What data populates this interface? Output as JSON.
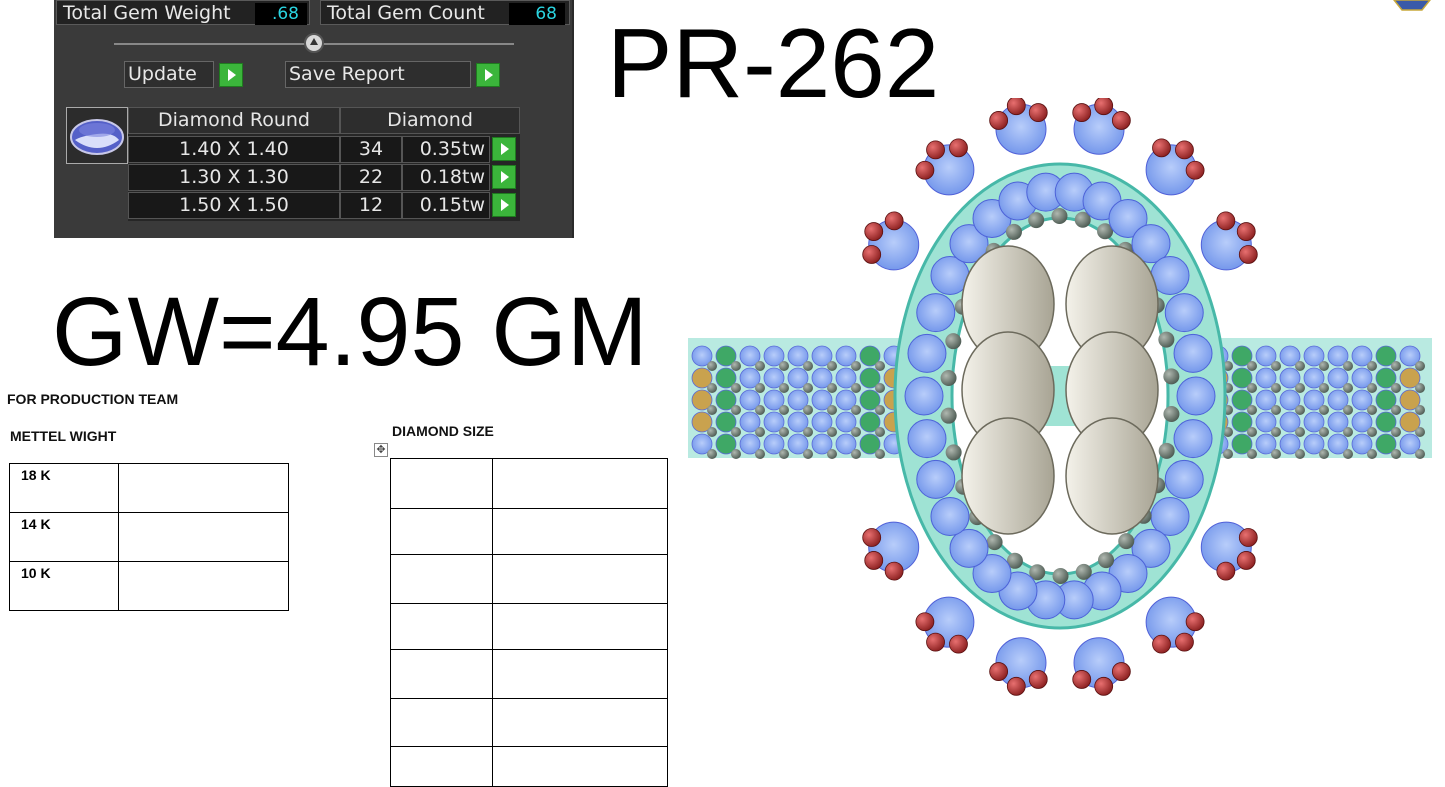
{
  "panel": {
    "total_gem_weight_label": "Total Gem Weight",
    "total_gem_weight_value": ".68",
    "total_gem_count_label": "Total Gem Count",
    "total_gem_count_value": "68",
    "update_label": "Update",
    "save_report_label": "Save Report",
    "table_headers": [
      "Diamond Round",
      "Diamond"
    ],
    "rows": [
      {
        "size": "1.40 X 1.40",
        "count": "34",
        "weight": "0.35tw"
      },
      {
        "size": "1.30 X 1.30",
        "count": "22",
        "weight": "0.18tw"
      },
      {
        "size": "1.50 X 1.50",
        "count": "12",
        "weight": "0.15tw"
      }
    ]
  },
  "title": "PR-262",
  "gross_weight": "GW=4.95 GM",
  "production": {
    "heading": "FOR PRODUCTION TEAM",
    "metal_weight_label": "METTEL WIGHT",
    "metal_rows": [
      {
        "karat": "18 K",
        "value": ""
      },
      {
        "karat": "14 K",
        "value": ""
      },
      {
        "karat": "10 K",
        "value": ""
      }
    ],
    "diamond_size_label": "DIAMOND SIZE"
  },
  "colors": {
    "panel_bg": "#3a3a3a",
    "value_text": "#2ad4e0",
    "button_green": "#3bb53b",
    "ring_band": "#7fd8c8",
    "diamond_blue": "#7fa6f2",
    "ruby_red": "#c23a3a"
  }
}
